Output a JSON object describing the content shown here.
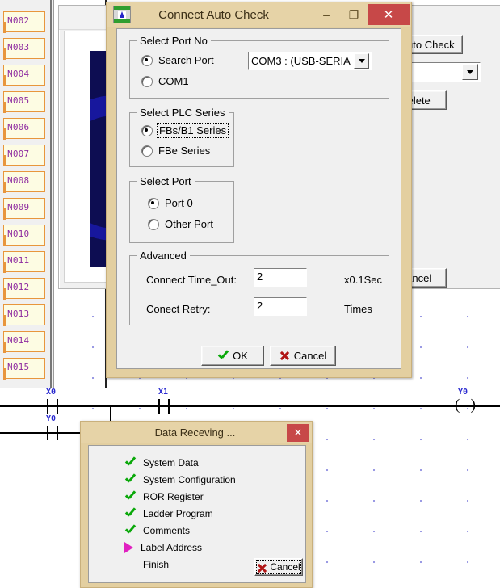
{
  "editor": {
    "row_labels": [
      "N002",
      "N003",
      "N004",
      "N005",
      "N006",
      "N007",
      "N008",
      "N009",
      "N010",
      "N011",
      "N012",
      "N013",
      "N014",
      "N015"
    ],
    "ladder": {
      "contacts": [
        {
          "label": "X0"
        },
        {
          "label": "Y0"
        },
        {
          "label": "X1"
        }
      ],
      "coil": {
        "label": "Y0"
      }
    },
    "grid_dot_color": "#8f8fe0",
    "row_label_color": "#8e2ba0",
    "row_box_border": "#e8963c"
  },
  "background_window": {
    "close_icon": "×",
    "auto_check_label": "Auto Check",
    "delete_label": "Delete",
    "cancel_label": "Cancel",
    "combo_value": "",
    "combo_arrow": "▼"
  },
  "dialog": {
    "title": "Connect Auto Check",
    "icon_name": "plc-app-icon",
    "minimize_glyph": "–",
    "maximize_glyph": "❐",
    "close_glyph": "✕",
    "titlebar_color": "#e6d3a7",
    "close_color": "#c74848",
    "groups": {
      "port_no": {
        "title": "Select Port No",
        "options": [
          {
            "label": "Search Port",
            "selected": true
          },
          {
            "label": "COM1",
            "selected": false
          }
        ],
        "combo_value": "COM3 : (USB-SERIA",
        "combo_arrow": "▼"
      },
      "plc_series": {
        "title": "Select PLC Series",
        "options": [
          {
            "label": "FBs/B1 Series",
            "selected": true,
            "focused": true
          },
          {
            "label": "FBe Series",
            "selected": false,
            "focused": false
          }
        ]
      },
      "port": {
        "title": "Select Port",
        "options": [
          {
            "label": "Port 0",
            "selected": true
          },
          {
            "label": "Other Port",
            "selected": false
          }
        ]
      },
      "advanced": {
        "title": "Advanced",
        "fields": [
          {
            "label": "Connect Time_Out:",
            "value": "2",
            "unit": "x0.1Sec"
          },
          {
            "label": "Conect Retry:",
            "value": "2",
            "unit": "Times"
          }
        ]
      }
    },
    "buttons": {
      "ok": "OK",
      "cancel": "Cancel"
    }
  },
  "progress_dialog": {
    "title": "Data Receving ...",
    "close_glyph": "✕",
    "steps": [
      {
        "label": "System Data",
        "state": "done"
      },
      {
        "label": "System Configuration",
        "state": "done"
      },
      {
        "label": "ROR Register",
        "state": "done"
      },
      {
        "label": "Ladder Program",
        "state": "done"
      },
      {
        "label": "Comments",
        "state": "done"
      },
      {
        "label": "Label Address",
        "state": "running"
      },
      {
        "label": "Finish",
        "state": "pending"
      }
    ],
    "cancel_label": "Cancel"
  },
  "colors": {
    "check_green": "#0aa80a",
    "running_magenta": "#e020c0",
    "x_red": "#b01616",
    "dialog_frame": "#e3cfa0"
  }
}
